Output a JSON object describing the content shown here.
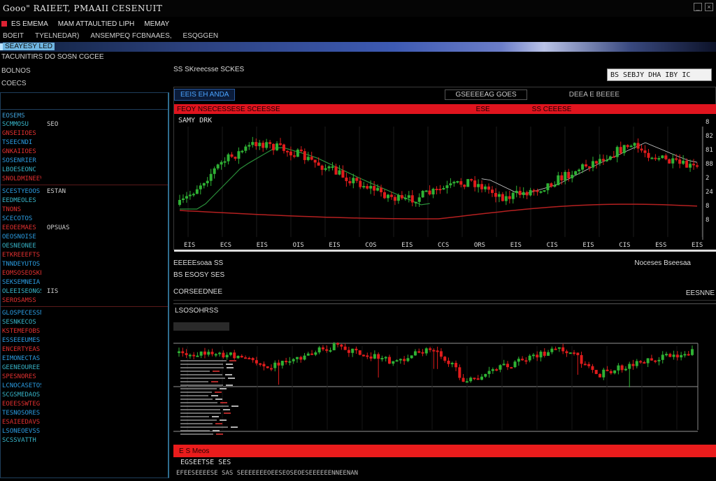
{
  "window": {
    "title": "Gooo\" RAIEET, PMAAII CESENUIT"
  },
  "menubar": {
    "items": [
      "ES EMEMA",
      "MAM ATTAULTIED LIPH",
      "MEMAY"
    ]
  },
  "toolbar": {
    "items": [
      "BOEIT",
      "TYELNEDAR)",
      "ANSEMPEQ FCBNAAES,",
      "ESQGGEN"
    ]
  },
  "banner": {
    "label": "SEAYESY LED"
  },
  "subheader": {
    "text": "TACUNITIRS DO SOSN CGCEE"
  },
  "sidebar": {
    "title": "BOLNOS",
    "subtitle": "COECS",
    "column_header": "EOSEMS",
    "rows": [
      {
        "sym": "SCMMOSU",
        "val": "SEO",
        "tone": "teal"
      },
      {
        "sym": "GNSEIIOES",
        "val": "",
        "tone": "red"
      },
      {
        "sym": "TSEECNDI",
        "val": "",
        "tone": "blue"
      },
      {
        "sym": "GNKAIIOES",
        "val": "",
        "tone": "red"
      },
      {
        "sym": "SOSENRIER",
        "val": "",
        "tone": "blue"
      },
      {
        "sym": "LBOESEONC",
        "val": "",
        "tone": "teal"
      },
      {
        "sym": "SNOLDMINEEVD",
        "val": "",
        "tone": "red"
      },
      {
        "sym": "SCESTYEOOS",
        "val": "ESTAN",
        "tone": "blue"
      },
      {
        "sym": "EEDMEOLES",
        "val": "",
        "tone": "teal"
      },
      {
        "sym": "TNONS",
        "val": "",
        "tone": "red"
      },
      {
        "sym": "SCECOTOS",
        "val": "",
        "tone": "blue"
      },
      {
        "sym": "EEOEEMAES",
        "val": "OPSUAS",
        "tone": "red"
      },
      {
        "sym": "OEOSNOISE",
        "val": "",
        "tone": "blue"
      },
      {
        "sym": "OESNEONEE",
        "val": "",
        "tone": "teal"
      },
      {
        "sym": "ETKREEEFTS",
        "val": "",
        "tone": "red"
      },
      {
        "sym": "TNNDEYUTOS",
        "val": "",
        "tone": "blue"
      },
      {
        "sym": "EOMSOSEOSKE",
        "val": "",
        "tone": "red"
      },
      {
        "sym": "SEKSEMNEIA",
        "val": "",
        "tone": "blue"
      },
      {
        "sym": "OLEEISEONGS",
        "val": "IIS",
        "tone": "teal"
      },
      {
        "sym": "SEROSAMSS",
        "val": "",
        "tone": "red"
      },
      {
        "sym": "GLOSPECESSN",
        "val": "",
        "tone": "blue"
      },
      {
        "sym": "SESNKECOS",
        "val": "",
        "tone": "teal"
      },
      {
        "sym": "KSTEMEFOBS",
        "val": "",
        "tone": "red"
      },
      {
        "sym": "ESSEEEUMES",
        "val": "",
        "tone": "blue"
      },
      {
        "sym": "ENCERTYEAS",
        "val": "",
        "tone": "red"
      },
      {
        "sym": "EIMONECTAS",
        "val": "",
        "tone": "blue"
      },
      {
        "sym": "GEENEOUREE",
        "val": "",
        "tone": "teal"
      },
      {
        "sym": "SPESNORES",
        "val": "",
        "tone": "red"
      },
      {
        "sym": "LCNOCASETOS",
        "val": "",
        "tone": "blue"
      },
      {
        "sym": "SCGSMEDAOS",
        "val": "",
        "tone": "teal"
      },
      {
        "sym": "EOEESSWTEG",
        "val": "",
        "tone": "red"
      },
      {
        "sym": "TESNOSORES",
        "val": "",
        "tone": "blue"
      },
      {
        "sym": "ESAIEEDAVS",
        "val": "",
        "tone": "red"
      },
      {
        "sym": "LSONEOEVSS",
        "val": "",
        "tone": "blue"
      },
      {
        "sym": "SCSSVATTH",
        "val": "",
        "tone": "teal"
      }
    ]
  },
  "main": {
    "caption": "SS SKreecsse SCKES",
    "search_value": "BS SEBJY DHA IBY IC"
  },
  "chart1": {
    "tab_active": "EEIS EH ANDA",
    "tab_mid": "GSEEEEAG GOES",
    "tab_right": "DEEA E BEEEE",
    "redbar": [
      "FEOY NSECESSESE SCEESSE",
      "ESE",
      "SS CEEESE"
    ],
    "legend": "SAMY DRK",
    "x_ticks": [
      "EIS",
      "ECS",
      "EIS",
      "OIS",
      "EIS",
      "COS",
      "EIS",
      "CCS",
      "ORS",
      "EIS",
      "CIS",
      "EIS",
      "CIS",
      "ESS",
      "EIS"
    ],
    "y_ticks": [
      "8",
      "82",
      "81",
      "88",
      "2",
      "24",
      "8",
      "8"
    ]
  },
  "mid_strip": {
    "left": "EEEEEsoaa SS",
    "right": "Noceses Bseesaa",
    "second": "BS ESOSY SES",
    "third": "CORSEEDNEE",
    "third_right": "EESNNE"
  },
  "chart2": {
    "title": "LSOSOHRSS"
  },
  "bottom": {
    "redbar": "E S Meos",
    "strip": "EGSEETSE SES",
    "strip2": "EFEESEEEESE SAS SEEEEEEEOEESEOSEOESEEEEEENNEENAN"
  },
  "colors": {
    "bull": "#2fb234",
    "bear": "#e01c1c",
    "ma_red": "#b52020",
    "ma_green": "#2a8f3a",
    "ma_white": "#cfcfcf"
  }
}
